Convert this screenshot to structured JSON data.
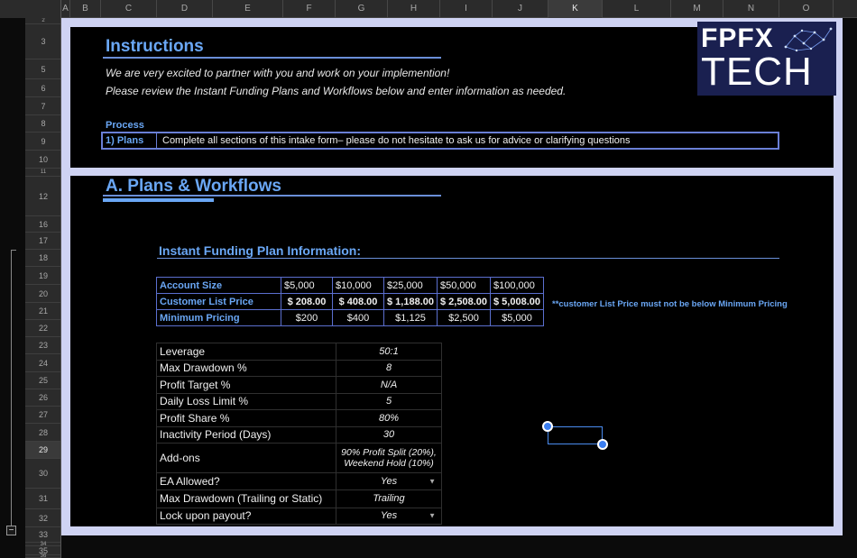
{
  "sheet": {
    "columns": [
      "A",
      "B",
      "C",
      "D",
      "E",
      "F",
      "G",
      "H",
      "I",
      "J",
      "K",
      "L",
      "M",
      "N",
      "O"
    ],
    "selected_column": "K",
    "rows": [
      "2",
      "3",
      "5",
      "6",
      "7",
      "8",
      "9",
      "10",
      "11",
      "12",
      "16",
      "17",
      "18",
      "19",
      "20",
      "21",
      "22",
      "23",
      "24",
      "25",
      "26",
      "27",
      "28",
      "29",
      "30",
      "31",
      "32",
      "33",
      "34",
      "35",
      "36"
    ],
    "selected_row": "29",
    "group_toggle": "−"
  },
  "logo": {
    "line1": "FPFX",
    "line2": "TECH"
  },
  "instructions": {
    "title": "Instructions",
    "line1": "We are very excited to partner with you and work on your implemention!",
    "line2": "Please review the Instant Funding Plans and Workflows below and enter information as needed.",
    "process_heading": "Process",
    "process_label": "1) Plans",
    "process_text": "Complete all sections of this intake form– please do not hesitate to ask us for advice or clarifying questions"
  },
  "plans": {
    "title": "A. Plans & Workflows",
    "subheading": "Instant Funding Plan Information:",
    "table": {
      "rows": [
        {
          "label": "Account Size",
          "values": [
            "$5,000",
            "$10,000",
            "$25,000",
            "$50,000",
            "$100,000"
          ]
        },
        {
          "label": "Customer List Price",
          "values": [
            "$  208.00",
            "$  408.00",
            "$  1,188.00",
            "$  2,508.00",
            "$  5,008.00"
          ]
        },
        {
          "label": "Minimum Pricing",
          "values": [
            "$200",
            "$400",
            "$1,125",
            "$2,500",
            "$5,000"
          ]
        }
      ]
    },
    "note": "**customer List Price must not be below Minimum Pricing",
    "settings": [
      {
        "key": "Leverage",
        "value": "50:1",
        "dropdown": false
      },
      {
        "key": "Max Drawdown %",
        "value": "8",
        "dropdown": false
      },
      {
        "key": "Profit Target %",
        "value": "N/A",
        "dropdown": false
      },
      {
        "key": "Daily Loss Limit %",
        "value": "5",
        "dropdown": false
      },
      {
        "key": "Profit Share %",
        "value": "80%",
        "dropdown": false
      },
      {
        "key": "Inactivity Period (Days)",
        "value": "30",
        "dropdown": false
      },
      {
        "key": "Add-ons",
        "value": "90% Profit Split (20%), Weekend Hold (10%)",
        "dropdown": false
      },
      {
        "key": "EA Allowed?",
        "value": "Yes",
        "dropdown": true
      },
      {
        "key": "Max Drawdown (Trailing or Static)",
        "value": "Trailing",
        "dropdown": false
      },
      {
        "key": "Lock upon payout?",
        "value": "Yes",
        "dropdown": true
      }
    ]
  }
}
